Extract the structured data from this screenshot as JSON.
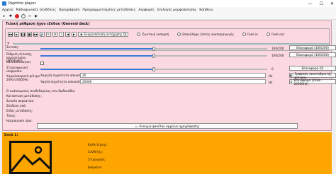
{
  "window": {
    "title": "Papinhio player",
    "minimize": "—",
    "maximize": "☐",
    "close": "✕"
  },
  "menu": [
    "Αρχείο",
    "Ραδιοφωνικές συνδέσεις",
    "Ηχογράφηση",
    "Προγραμματισμένες μεταδόσεις",
    "Αναφορές",
    "Επιλογές μορφοποίησης",
    "Βοήθεια"
  ],
  "toolbar_icons": [
    "run-icon",
    "settings-icon",
    "record-icon",
    "stop-icon",
    "headphones-icon",
    "play-icon"
  ],
  "general_deck": {
    "title": "Τελική ρύθμιση ήχου εξόδου (General deck)",
    "control_buttons": [
      "◀◀",
      "▶",
      "❚❚",
      "■",
      "▶▶",
      "🔊",
      "✎",
      "⚙",
      "⇩",
      "◀",
      "▶"
    ],
    "deck_button": "Ενεργοποίηση αντήχησης DJ",
    "radios": [
      "Ζωντανή εκπομπή",
      "Επανάληψη λίστας αναπαραγωγής",
      "Fade in",
      "Fade out"
    ]
  },
  "rows": {
    "volume": {
      "label": "Ένταση:",
      "value": "100/200",
      "percent": 50,
      "button": "Επαναφορά (100/200)"
    },
    "speed": {
      "label": "Ρύθμιση έντασης ακροατηρίου (Windows):",
      "value": "100/200",
      "percent": 50,
      "button": "Επαναφορά (100/200)"
    },
    "normalize": {
      "label": "Κανονικοποίηση:"
    },
    "pan": {
      "label": "Στερεοφωνική ισορροπία:",
      "value": "0",
      "percent": 50,
      "button": "Επαναφορά (0)"
    },
    "filter": {
      "label": "Χαμηλοπερατό φίλτρο 20Hz-20000Hz",
      "low_label": "Χαμηλή συχνότητα αποκοπής:",
      "low_value": "20",
      "low_unit": "Hz",
      "high_label": "Υψηλή συχνότητα αποκοπής:",
      "high_value": "20000",
      "high_unit": "Hz",
      "eq_button": "Γραφικός ισοσταθμιστής φίλτρου",
      "reset_button": "Επαναφορά (20Hz - 20000Hz)"
    }
  },
  "info_lines": [
    "Ο αναλυομενος συνδεδεμένος στο δωδεκάδιο:",
    "Κατάσταση μετάδοσης:",
    "Συνολο ακροατών:",
    "Σύνδεση από:",
    "Είδος μετάδοσης:",
    "Τύπος:",
    "Ημερομηνία ώρα:"
  ],
  "browse_button": "Άνοιγμα φακέλου αρχείων ηχογράφησης",
  "deck1": {
    "title": "Deck 1:",
    "fields": [
      "Καλλιτέχνης:",
      "Συνθέτης:",
      "Στιχουργός:",
      "Διάρκεια:"
    ]
  }
}
